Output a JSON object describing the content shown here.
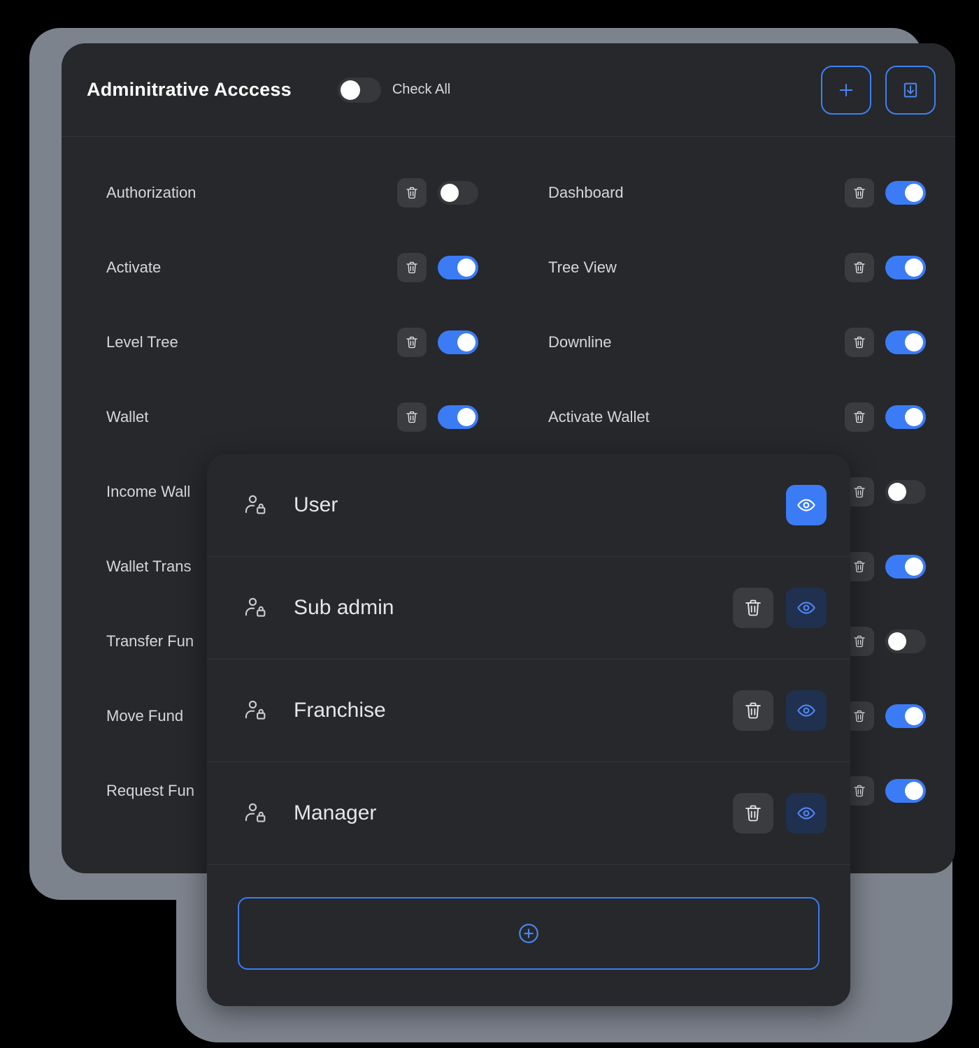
{
  "header": {
    "title": "Adminitrative Acccess",
    "check_all_label": "Check All",
    "check_all_state": "off",
    "add_button_icon": "plus-icon",
    "save_button_icon": "save-download-icon"
  },
  "colors": {
    "accent_blue": "#3b7bf6",
    "outline_blue": "#3b82f6",
    "panel_bg": "#26282b",
    "frame_gray": "#7d838d",
    "page_bg": "#000000",
    "icon_btn_bg": "#3a3c40",
    "eye_off_bg": "#20304f",
    "toggle_off_track": "#36383c"
  },
  "permissions": {
    "left_column": [
      {
        "label": "Authorization",
        "toggle": "off",
        "delete_icon": "trash-icon"
      },
      {
        "label": "Activate",
        "toggle": "on",
        "delete_icon": "trash-icon"
      },
      {
        "label": "Level Tree",
        "toggle": "on",
        "delete_icon": "trash-icon"
      },
      {
        "label": "Wallet",
        "toggle": "on",
        "delete_icon": "trash-icon"
      },
      {
        "label": "Income Wall",
        "toggle": "on",
        "delete_icon": "trash-icon"
      },
      {
        "label": "Wallet Trans",
        "toggle": "on",
        "delete_icon": "trash-icon"
      },
      {
        "label": "Transfer Fun",
        "toggle": "on",
        "delete_icon": "trash-icon"
      },
      {
        "label": "Move Fund",
        "toggle": "on",
        "delete_icon": "trash-icon"
      },
      {
        "label": "Request Fun",
        "toggle": "on",
        "delete_icon": "trash-icon"
      }
    ],
    "right_column": [
      {
        "label": "Dashboard",
        "toggle": "on",
        "delete_icon": "trash-icon"
      },
      {
        "label": "Tree View",
        "toggle": "on",
        "delete_icon": "trash-icon"
      },
      {
        "label": "Downline",
        "toggle": "on",
        "delete_icon": "trash-icon"
      },
      {
        "label": "Activate Wallet",
        "toggle": "on",
        "delete_icon": "trash-icon"
      },
      {
        "label": "",
        "toggle": "off",
        "delete_icon": "trash-icon"
      },
      {
        "label": "",
        "toggle": "on",
        "delete_icon": "trash-icon"
      },
      {
        "label": "",
        "toggle": "off",
        "delete_icon": "trash-icon"
      },
      {
        "label": "",
        "toggle": "on",
        "delete_icon": "trash-icon"
      },
      {
        "label": "",
        "toggle": "on",
        "delete_icon": "trash-icon"
      }
    ]
  },
  "role_modal": {
    "roles": [
      {
        "name": "User",
        "user_icon": "user-lock-icon",
        "has_delete": false,
        "eye_state": "active"
      },
      {
        "name": "Sub admin",
        "user_icon": "user-lock-icon",
        "has_delete": true,
        "eye_state": "inactive"
      },
      {
        "name": "Franchise",
        "user_icon": "user-lock-icon",
        "has_delete": true,
        "eye_state": "inactive"
      },
      {
        "name": "Manager",
        "user_icon": "user-lock-icon",
        "has_delete": true,
        "eye_state": "inactive"
      }
    ],
    "add_button_icon": "circle-plus-icon"
  }
}
